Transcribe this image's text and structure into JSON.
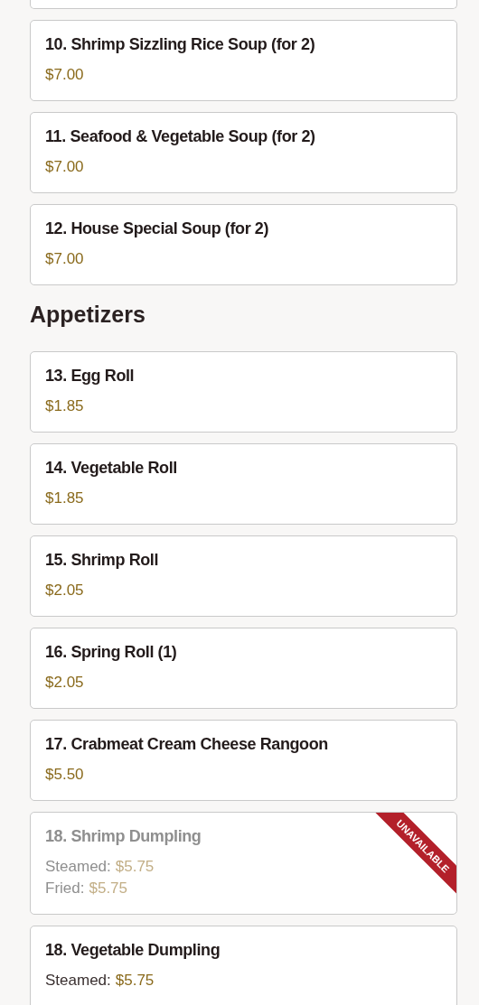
{
  "sections": [
    {
      "items": [
        {
          "kind": "stub"
        },
        {
          "kind": "single",
          "name": "10. Shrimp Sizzling Rice Soup (for 2)",
          "price": "$7.00",
          "unavailable": false
        },
        {
          "kind": "single",
          "name": "11. Seafood & Vegetable Soup (for 2)",
          "price": "$7.00",
          "unavailable": false
        },
        {
          "kind": "single",
          "name": "12. House Special Soup (for 2)",
          "price": "$7.00",
          "unavailable": false
        }
      ]
    },
    {
      "heading": "Appetizers",
      "items": [
        {
          "kind": "single",
          "name": "13. Egg Roll",
          "price": "$1.85",
          "unavailable": false
        },
        {
          "kind": "single",
          "name": "14. Vegetable Roll",
          "price": "$1.85",
          "unavailable": false
        },
        {
          "kind": "single",
          "name": "15. Shrimp Roll",
          "price": "$2.05",
          "unavailable": false
        },
        {
          "kind": "single",
          "name": "16. Spring Roll (1)",
          "price": "$2.05",
          "unavailable": false
        },
        {
          "kind": "single",
          "name": "17. Crabmeat Cream Cheese Rangoon",
          "price": "$5.50",
          "unavailable": false
        },
        {
          "kind": "options",
          "name": "18. Shrimp Dumpling",
          "options": [
            {
              "label": "Steamed:",
              "price": "$5.75"
            },
            {
              "label": "Fried:",
              "price": "$5.75"
            }
          ],
          "unavailable": true,
          "ribbon": "UNAVAILABLE"
        },
        {
          "kind": "options",
          "name": "18. Vegetable Dumpling",
          "options": [
            {
              "label": "Steamed:",
              "price": "$5.75"
            }
          ],
          "unavailable": false
        }
      ]
    }
  ]
}
